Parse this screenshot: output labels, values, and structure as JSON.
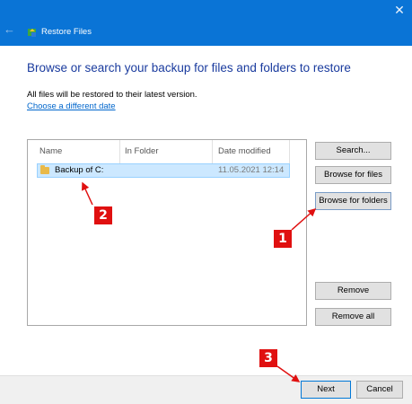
{
  "window": {
    "title": "Restore Files",
    "close_symbol": "✕",
    "back_symbol": "←"
  },
  "main": {
    "heading": "Browse or search your backup for files and folders to restore",
    "info": "All files will be restored to their latest version.",
    "link": "Choose a different date"
  },
  "list": {
    "columns": [
      "Name",
      "In Folder",
      "Date modified"
    ],
    "rows": [
      {
        "name": "Backup of C:",
        "in_folder": "",
        "date_modified": "11.05.2021 12:14",
        "selected": true
      }
    ]
  },
  "buttons": {
    "search": "Search...",
    "browse_files": "Browse for files",
    "browse_folders": "Browse for folders",
    "remove": "Remove",
    "remove_all": "Remove all",
    "next": "Next",
    "cancel": "Cancel"
  },
  "annotations": {
    "step1": "1",
    "step2": "2",
    "step3": "3"
  },
  "colors": {
    "titlebar": "#0a74d6",
    "heading": "#1a3b9e",
    "selection": "#cce8ff",
    "badge": "#e01010"
  }
}
